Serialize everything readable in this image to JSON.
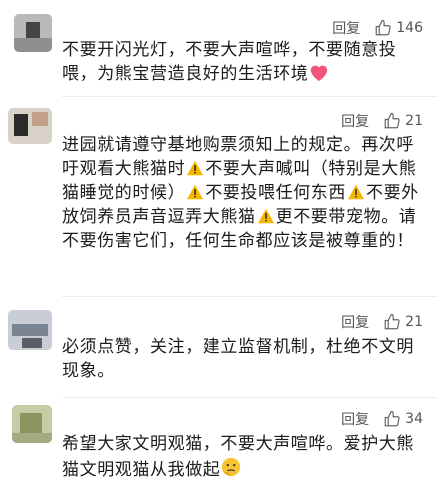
{
  "comments": [
    {
      "reply_label": "回复",
      "like_count": "146",
      "text_parts": [
        "不要开闪光灯，不要大声喧哗，不要随意投喂，为熊宝营造良好的生活环境"
      ],
      "emoji": "heart-icon"
    },
    {
      "reply_label": "回复",
      "like_count": "21",
      "text_parts": [
        "进园就请遵守基地购票须知上的规定。再次呼吁观看大熊猫时",
        "不要大声喊叫（特别是大熊猫睡觉的时候）",
        "不要投喂任何东西",
        "不要外放饲养员声音逗弄大熊猫",
        "更不要带宠物。请不要伤害它们，任何生命都应该是被尊重的！"
      ],
      "emoji": "warning-icon"
    },
    {
      "reply_label": "回复",
      "like_count": "21",
      "text_parts": [
        "必须点赞，关注，建立监督机制，杜绝不文明现象。"
      ]
    },
    {
      "reply_label": "回复",
      "like_count": "34",
      "text_parts": [
        "希望大家文明观猫，不要大声喧哗。爱护大熊猫文明观猫从我做起"
      ],
      "emoji": "thinking-face-icon"
    }
  ],
  "colors": {
    "warning": "#f5b800",
    "heart": "#f2557a",
    "icon_grey": "#666666"
  }
}
